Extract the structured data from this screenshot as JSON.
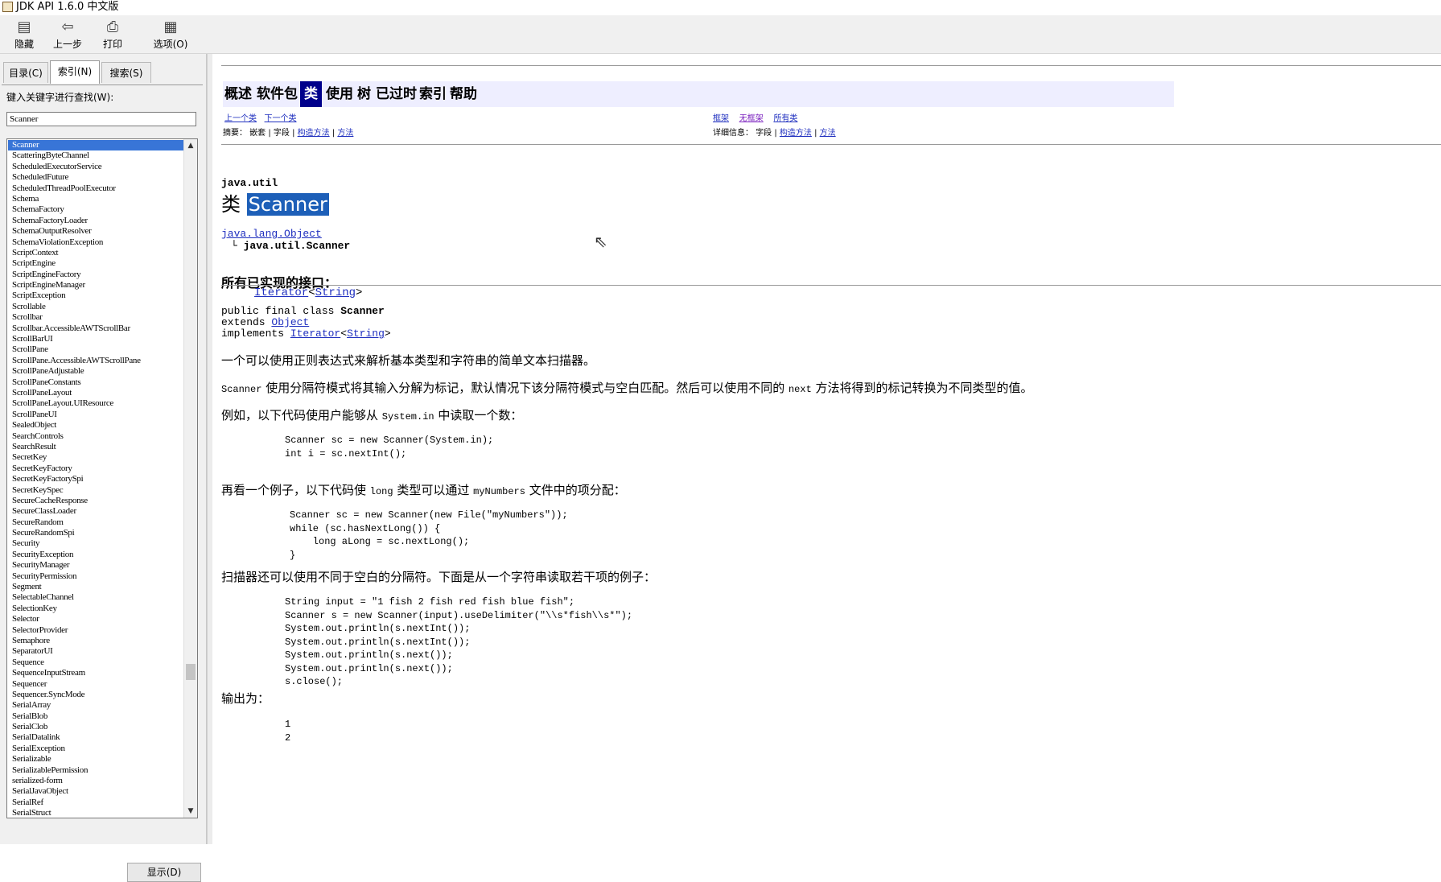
{
  "window": {
    "title": "JDK API 1.6.0 中文版"
  },
  "toolbar": {
    "hide": "隐藏",
    "back": "上一步",
    "print": "打印",
    "options": "选项(O)"
  },
  "left_tabs": {
    "contents": "目录(C)",
    "index": "索引(N)",
    "search": "搜索(S)"
  },
  "index_panel": {
    "label": "键入关键字进行查找(W):",
    "input_value": "Scanner",
    "display_button": "显示(D)",
    "items": [
      "Scanner",
      "ScatteringByteChannel",
      "ScheduledExecutorService",
      "ScheduledFuture",
      "ScheduledThreadPoolExecutor",
      "Schema",
      "SchemaFactory",
      "SchemaFactoryLoader",
      "SchemaOutputResolver",
      "SchemaViolationException",
      "ScriptContext",
      "ScriptEngine",
      "ScriptEngineFactory",
      "ScriptEngineManager",
      "ScriptException",
      "Scrollable",
      "Scrollbar",
      "Scrollbar.AccessibleAWTScrollBar",
      "ScrollBarUI",
      "ScrollPane",
      "ScrollPane.AccessibleAWTScrollPane",
      "ScrollPaneAdjustable",
      "ScrollPaneConstants",
      "ScrollPaneLayout",
      "ScrollPaneLayout.UIResource",
      "ScrollPaneUI",
      "SealedObject",
      "SearchControls",
      "SearchResult",
      "SecretKey",
      "SecretKeyFactory",
      "SecretKeyFactorySpi",
      "SecretKeySpec",
      "SecureCacheResponse",
      "SecureClassLoader",
      "SecureRandom",
      "SecureRandomSpi",
      "Security",
      "SecurityException",
      "SecurityManager",
      "SecurityPermission",
      "Segment",
      "SelectableChannel",
      "SelectionKey",
      "Selector",
      "SelectorProvider",
      "Semaphore",
      "SeparatorUI",
      "Sequence",
      "SequenceInputStream",
      "Sequencer",
      "Sequencer.SyncMode",
      "SerialArray",
      "SerialBlob",
      "SerialClob",
      "SerialDatalink",
      "SerialException",
      "Serializable",
      "SerializablePermission",
      "serialized-form",
      "SerialJavaObject",
      "SerialRef",
      "SerialStruct"
    ]
  },
  "nav": {
    "overview": "概述",
    "package": "软件包",
    "class": "类",
    "use": "使用",
    "tree": "树",
    "deprecated": "已过时",
    "index": "索引",
    "help": "帮助"
  },
  "subnav": {
    "prev_class": "上一个类",
    "next_class": "下一个类",
    "frames": "框架",
    "no_frames": "无框架",
    "all_classes": "所有类",
    "summary_label": "摘要：",
    "nested": "嵌套",
    "field": "字段",
    "constructor": "构造方法",
    "method": "方法",
    "detail_label": "详细信息：",
    "d_field": "字段",
    "d_constructor": "构造方法",
    "d_method": "方法",
    "sep": " | "
  },
  "doc": {
    "package": "java.util",
    "class_prefix": "类",
    "class_name": "Scanner",
    "inherit_link": "java.lang.Object",
    "inherit_self_prefix": "└ ",
    "inherit_self": "java.util.Scanner",
    "impl_label": "所有已实现的接口：",
    "impl_iface": "Iterator",
    "impl_type": "String",
    "lt": "<",
    "gt": ">",
    "decl_line1_prefix": "public final class ",
    "decl_line1_name": "Scanner",
    "decl_line2_prefix": "extends ",
    "decl_line2_link": "Object",
    "decl_line3_prefix": "implements ",
    "decl_line3_link": "Iterator",
    "decl_line3_type": "String",
    "p1": "一个可以使用正则表达式来解析基本类型和字符串的简单文本扫描器。",
    "p2_code1": "Scanner",
    "p2_text1": " 使用分隔符模式将其输入分解为标记，默认情况下该分隔符模式与空白匹配。然后可以使用不同的 ",
    "p2_code2": "next",
    "p2_text2": " 方法将得到的标记转换为不同类型的值。",
    "p3_text1": "例如，以下代码使用户能够从 ",
    "p3_code": "System.in",
    "p3_text2": " 中读取一个数：",
    "code1": "Scanner sc = new Scanner(System.in);\nint i = sc.nextInt();",
    "p4_text1": "再看一个例子，以下代码使 ",
    "p4_code1": "long",
    "p4_text2": " 类型可以通过 ",
    "p4_code2": "myNumbers",
    "p4_text3": " 文件中的项分配：",
    "code2": "Scanner sc = new Scanner(new File(\"myNumbers\"));\nwhile (sc.hasNextLong()) {\n    long aLong = sc.nextLong();\n}",
    "p5": "扫描器还可以使用不同于空白的分隔符。下面是从一个字符串读取若干项的例子：",
    "code3": "String input = \"1 fish 2 fish red fish blue fish\";\nScanner s = new Scanner(input).useDelimiter(\"\\\\s*fish\\\\s*\");\nSystem.out.println(s.nextInt());\nSystem.out.println(s.nextInt());\nSystem.out.println(s.next());\nSystem.out.println(s.next());\ns.close();",
    "p6": "输出为：",
    "code4": "1\n2"
  }
}
